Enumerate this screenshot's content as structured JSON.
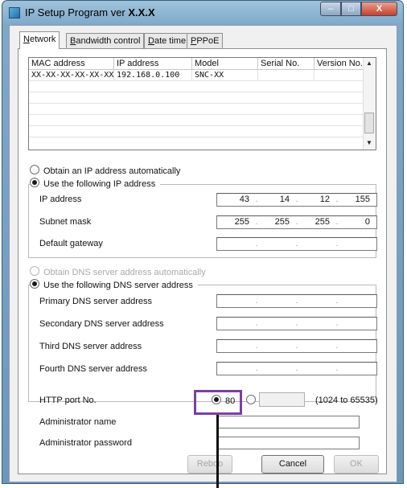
{
  "window": {
    "title_prefix": "IP Setup Program ver",
    "title_version": "X.X.X",
    "min_label": "–",
    "max_label": "□",
    "close_label": "X"
  },
  "tabs": [
    {
      "access_key": "N",
      "rest": "etwork"
    },
    {
      "access_key": "B",
      "rest": "andwidth control"
    },
    {
      "access_key": "D",
      "rest": "ate time"
    },
    {
      "access_key": "P",
      "rest": "PPoE"
    }
  ],
  "device_list": {
    "columns": [
      "MAC address",
      "IP address",
      "Model",
      "Serial No.",
      "Version No."
    ],
    "rows": [
      [
        "XX-XX-XX-XX-XX-XX",
        "192.168.0.100",
        "SNC-XX",
        "",
        ""
      ]
    ],
    "scroll_up": "▲",
    "scroll_down": "▼"
  },
  "ip_settings": {
    "obtain_auto_label": "Obtain an IP address automatically",
    "use_following_label": "Use the following IP address",
    "ip_address_label": "IP address",
    "subnet_mask_label": "Subnet mask",
    "default_gateway_label": "Default gateway",
    "ip_address": [
      "43",
      "14",
      "12",
      "155"
    ],
    "subnet_mask": [
      "255",
      "255",
      "255",
      "0"
    ],
    "default_gateway": [
      "",
      "",
      "",
      ""
    ]
  },
  "dns_settings": {
    "obtain_auto_label": "Obtain DNS server address automatically",
    "use_following_label": "Use the following DNS server address",
    "primary_label": "Primary DNS server address",
    "secondary_label": "Secondary DNS server address",
    "third_label": "Third DNS server address",
    "fourth_label": "Fourth DNS server address"
  },
  "http": {
    "port_label": "HTTP port No.",
    "default_port": "80",
    "custom_port_value": "",
    "range_hint": "(1024 to 65535)"
  },
  "admin": {
    "name_label": "Administrator name",
    "password_label": "Administrator password",
    "name_value": "",
    "password_value": ""
  },
  "buttons": {
    "reboot": "Reboo",
    "cancel": "Cancel",
    "ok": "OK"
  },
  "dot_char": "."
}
